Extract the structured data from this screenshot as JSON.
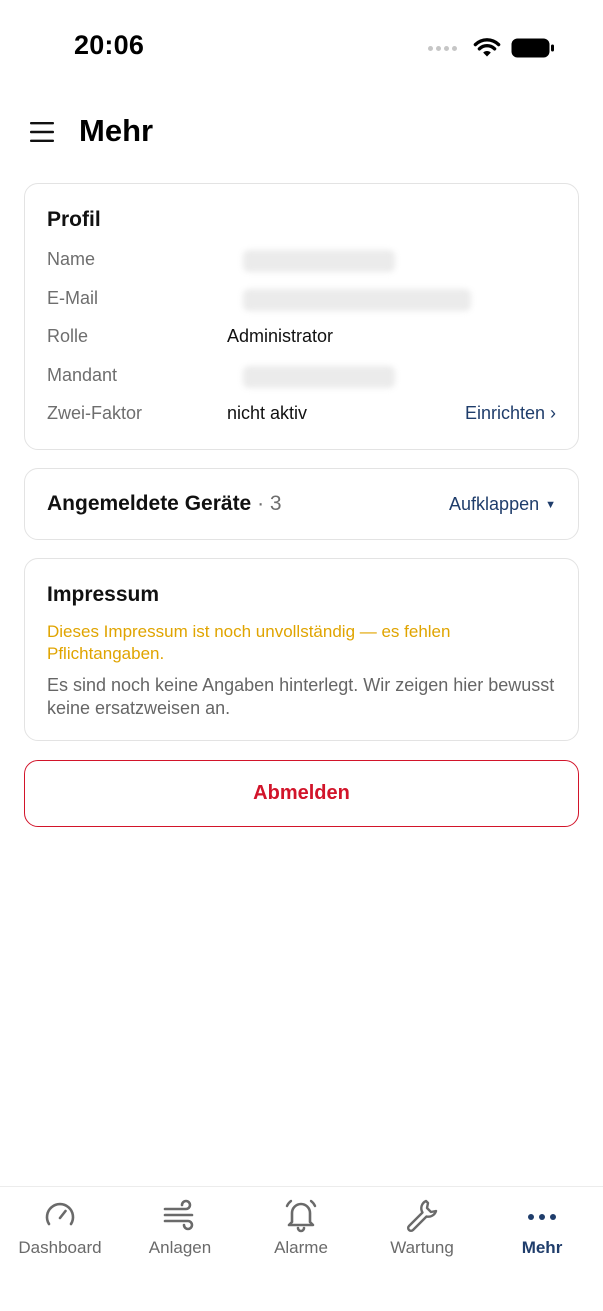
{
  "status_bar": {
    "time": "20:06"
  },
  "header": {
    "title": "Mehr"
  },
  "profile": {
    "title": "Profil",
    "rows": [
      {
        "label": "Name",
        "value": ""
      },
      {
        "label": "E-Mail",
        "value": ""
      },
      {
        "label": "Rolle",
        "value": "Administrator"
      },
      {
        "label": "Mandant",
        "value": ""
      },
      {
        "label": "Zwei-Faktor",
        "value": "nicht aktiv",
        "action": "Einrichten ›"
      }
    ]
  },
  "devices": {
    "title": "Angemeldete Geräte",
    "count": " · 3",
    "toggle_label": "Aufklappen",
    "toggle_icon": "caret-down-icon"
  },
  "imprint": {
    "title": "Impressum",
    "warning": "Dieses Impressum ist noch unvollständig — es fehlen Pflichtangaben.",
    "text": "Es sind noch keine Angaben hinterlegt. Wir zeigen hier bewusst keine ersatzweisen an."
  },
  "logout": {
    "label": "Abmelden"
  },
  "tabbar": {
    "items": [
      {
        "label": "Dashboard",
        "icon": "gauge-icon",
        "active": false
      },
      {
        "label": "Anlagen",
        "icon": "wind-icon",
        "active": false
      },
      {
        "label": "Alarme",
        "icon": "bell-icon",
        "active": false
      },
      {
        "label": "Wartung",
        "icon": "wrench-icon",
        "active": false
      },
      {
        "label": "Mehr",
        "icon": "more-dots-icon",
        "active": true
      }
    ]
  },
  "colors": {
    "accent": "#1f3d6b",
    "danger": "#d2142a",
    "warning": "#e0a400"
  }
}
